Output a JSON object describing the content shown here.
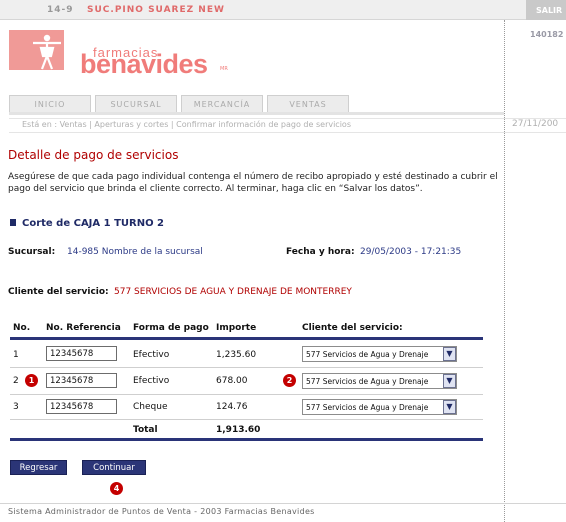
{
  "topbar": {
    "code": "14-9",
    "branch": "SUC.PINO SUAREZ NEW",
    "exit": "SALIR",
    "terminal_id": "140182"
  },
  "logo": {
    "small": "farmacias",
    "big": "benavides",
    "mark": "MR"
  },
  "tabs": [
    {
      "label": "INICIO"
    },
    {
      "label": "SUCURSAL"
    },
    {
      "label": "MERCANCÍA"
    },
    {
      "label": "VENTAS"
    }
  ],
  "breadcrumb": {
    "text": "Está en : Ventas | Aperturas y cortes | Confirmar información de pago de servicios",
    "date": "27/11/200"
  },
  "page": {
    "title": "Detalle de pago de servicios",
    "description": "Asegúrese de que cada pago individual contenga el número de recibo apropiado y esté destinado a cubrir el pago del servicio que brinda el cliente correcto. Al terminar, haga clic en “Salvar los datos”.",
    "corte": "Corte de CAJA 1 TURNO 2",
    "sucursal_label": "Sucursal:",
    "sucursal_value": "14-985 Nombre de la sucursal",
    "fecha_label": "Fecha y hora:",
    "fecha_value": "29/05/2003 - 17:21:35",
    "cliente_label": "Cliente del servicio:",
    "cliente_value": "577 SERVICIOS DE AGUA Y DRENAJE DE MONTERREY"
  },
  "table": {
    "headers": [
      "No.",
      "No. Referencia",
      "Forma de pago",
      "Importe",
      "Cliente del servicio:"
    ],
    "rows": [
      {
        "no": "1",
        "ref": "12345678",
        "forma": "Efectivo",
        "importe": "1,235.60",
        "cliente": "577 Servicios de Agua y Drenaje"
      },
      {
        "no": "2",
        "ref": "12345678",
        "forma": "Efectivo",
        "importe": "678.00",
        "cliente": "577 Servicios de Agua y Drenaje"
      },
      {
        "no": "3",
        "ref": "12345678",
        "forma": "Cheque",
        "importe": "124.76",
        "cliente": "577 Servicios de Agua y Drenaje"
      }
    ],
    "total_label": "Total",
    "total_value": "1,913.60"
  },
  "badges": {
    "b1": "1",
    "b2": "2",
    "b4": "4"
  },
  "buttons": {
    "back": "Regresar",
    "continue": "Continuar"
  },
  "footer": "Sistema Administrador de Puntos de Venta - 2003 Farmacias Benavides",
  "icons": {
    "select_arrow": "chevron-down-icon"
  },
  "colors": {
    "accent": "#2b3577",
    "brand": "#f07c7a",
    "title_red": "#b00000"
  }
}
